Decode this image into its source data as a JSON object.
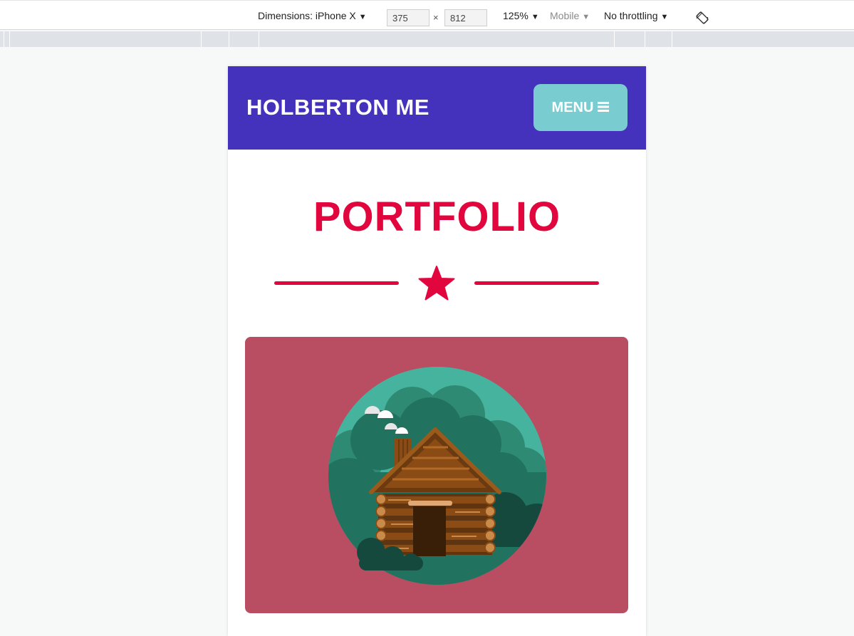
{
  "devtools": {
    "device_label": "Dimensions: iPhone X",
    "width_value": "375",
    "times_symbol": "×",
    "height_value": "812",
    "zoom_label": "125%",
    "mode_label": "Mobile",
    "throttle_label": "No throttling",
    "dropdown_arrow": "▼",
    "rotate_icon": "rotate-device-icon"
  },
  "site": {
    "brand": "HOLBERTON ME",
    "menu_label": "MENU",
    "menu_icon": "hamburger-icon",
    "header_color": "#4432bd",
    "menu_color": "#79cdd0",
    "accent_color": "#e2063f"
  },
  "portfolio": {
    "title": "PORTFOLIO",
    "divider_icon": "star-icon",
    "card_color": "#b94e63",
    "card_image": "log-cabin-illustration"
  }
}
